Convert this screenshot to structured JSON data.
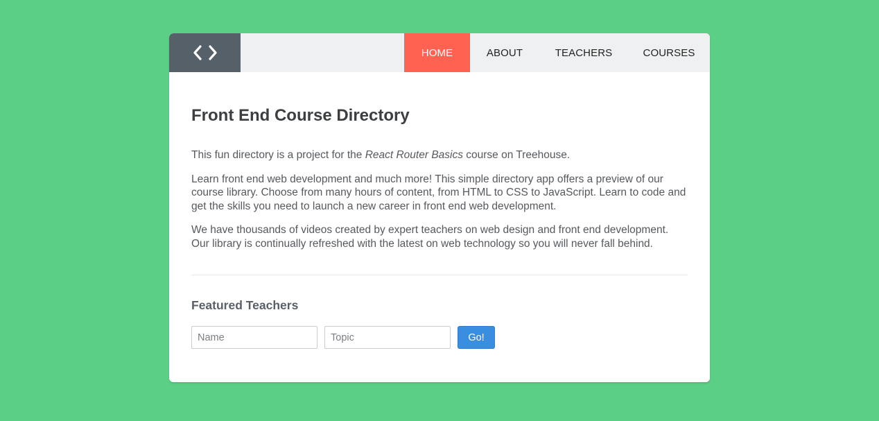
{
  "colors": {
    "page_background": "#5ccf86",
    "logo_background": "#556068",
    "header_background": "#eef0f1",
    "active_nav": "#ff6250",
    "button": "#3a8ee0"
  },
  "header": {
    "logo_icon": "code-brackets-icon",
    "nav": [
      {
        "label": "HOME",
        "active": true
      },
      {
        "label": "ABOUT",
        "active": false
      },
      {
        "label": "TEACHERS",
        "active": false
      },
      {
        "label": "COURSES",
        "active": false
      }
    ]
  },
  "main": {
    "title": "Front End Course Directory",
    "intro": {
      "prefix": "This fun directory is a project for the ",
      "emphasis": "React Router Basics",
      "suffix": " course on Treehouse."
    },
    "paragraph2": "Learn front end web development and much more! This simple directory app offers a preview of our course library. Choose from many hours of content, from HTML to CSS to JavaScript. Learn to code and get the skills you need to launch a new career in front end web development.",
    "paragraph3": "We have thousands of videos created by expert teachers on web design and front end development. Our library is continually refreshed with the latest on web technology so you will never fall behind."
  },
  "featured": {
    "title": "Featured Teachers",
    "name_placeholder": "Name",
    "topic_placeholder": "Topic",
    "button_label": "Go!"
  }
}
